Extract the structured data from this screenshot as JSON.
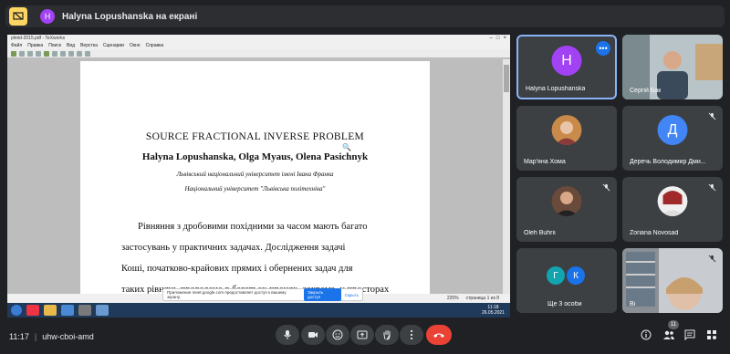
{
  "presenting_bar": {
    "avatar_letter": "H",
    "text": "Halyna Lopushanska на екрані"
  },
  "shared_screen": {
    "window_title": "plmid-2015.pdf - TeXworks",
    "menu": [
      "Файл",
      "Правка",
      "Поиск",
      "Вид",
      "Верстка",
      "Сценарии",
      "Окно",
      "Справка"
    ],
    "document": {
      "title": "SOURCE FRACTIONAL INVERSE PROBLEM",
      "authors": "Halyna Lopushanska, Olga Myaus, Olena Pasichnyk",
      "affiliation1": "Львівський національний університет імені Івана Франка",
      "affiliation2": "Національний університет \"Львівська політехніка\"",
      "body_lines": [
        "Рівняння з дробовими похідними за часом мають багато",
        "застосувань у практичних задачах.  Дослідження задачі",
        "Коші, початково-крайових прямих і обернених задач для",
        "таких рівнянь проведено в багатьох працях, зокрема, у просторах"
      ]
    },
    "status": {
      "zoom": "225%",
      "page": "страница 1 из 8"
    },
    "notice": {
      "text": "Приложение meet.google.com предоставляет доступ к вашему экрану.",
      "share_button": "Закрыть доступ",
      "hide_link": "Скрыть"
    },
    "clock": {
      "time": "11:18",
      "date": "26.05.2021"
    }
  },
  "tiles": [
    {
      "name": "Halyna Lopushanska",
      "avatar": "H",
      "avatar_color": "#a142f4",
      "active": true
    },
    {
      "name": "Сергій Бак",
      "avatar": "",
      "photo": true
    },
    {
      "name": "Мар'яна Хома",
      "avatar": "",
      "photo": true,
      "muted": false
    },
    {
      "name": "Деречь Володимир Дми...",
      "avatar": "Д",
      "avatar_color": "#4285f4",
      "muted": true
    },
    {
      "name": "Oleh Buhrii",
      "avatar": "",
      "photo": true,
      "muted": true
    },
    {
      "name": "Zoriana Novosad",
      "avatar": "",
      "photo": true,
      "muted": true
    },
    {
      "name": "Ще 3 особи",
      "avatars": [
        "Г",
        "К"
      ],
      "avatar_colors": [
        "#12a4af",
        "#1a73e8"
      ]
    },
    {
      "name": "Ві",
      "avatar": "",
      "photo": true,
      "muted": true
    }
  ],
  "bottom_bar": {
    "time": "11:17",
    "separator": "|",
    "meeting_code": "uhw-cboi-amd",
    "participants_count": "11"
  },
  "colors": {
    "background": "#202124",
    "tile": "#3c4043",
    "end_call": "#ea4335",
    "accent": "#8ab4f8"
  }
}
